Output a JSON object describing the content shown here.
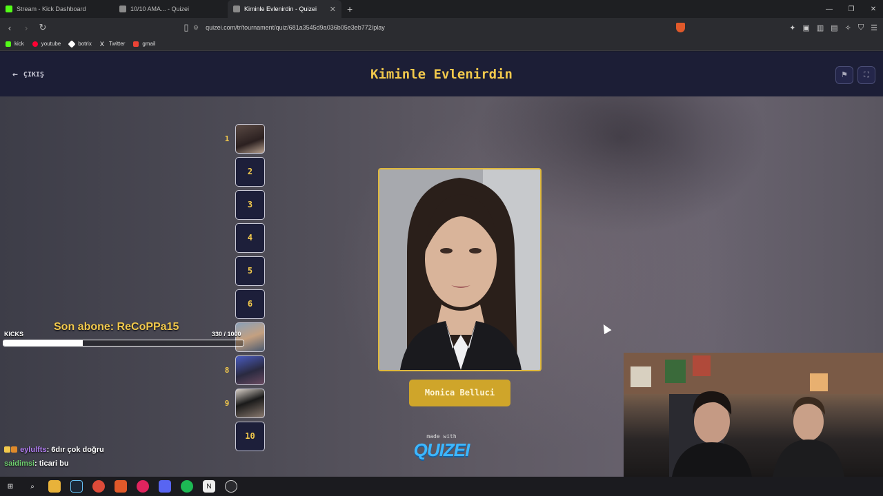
{
  "browser": {
    "tabs": [
      {
        "title": "Stream - Kick Dashboard",
        "active": false,
        "favicon_color": "#53fc18"
      },
      {
        "title": "10/10 AMA... - Quizei",
        "active": false,
        "favicon_color": "#8a8a8a"
      },
      {
        "title": "Kiminle Evlenirdin - Quizei",
        "active": true,
        "favicon_color": "#8a8a8a"
      }
    ],
    "new_tab": "+",
    "url": "quizei.com/tr/tournament/quiz/681a3545d9a036b05e3eb772/play",
    "bookmarks": [
      {
        "label": "kick",
        "color": "#53fc18"
      },
      {
        "label": "youtube",
        "color": "#ff0033"
      },
      {
        "label": "botrix",
        "color": "#ffffff"
      },
      {
        "label": "Twitter",
        "color": "#ffffff"
      },
      {
        "label": "gmail",
        "color": "#ea4335"
      }
    ]
  },
  "quiz": {
    "exit_label": "ÇIKIŞ",
    "title": "Kiminle Evlenirdin",
    "ranks": [
      {
        "num": "1",
        "filled": true,
        "label": ""
      },
      {
        "num": "",
        "filled": false,
        "label": "2"
      },
      {
        "num": "",
        "filled": false,
        "label": "3"
      },
      {
        "num": "",
        "filled": false,
        "label": "4"
      },
      {
        "num": "",
        "filled": false,
        "label": "5"
      },
      {
        "num": "",
        "filled": false,
        "label": "6"
      },
      {
        "num": "",
        "filled": true,
        "label": ""
      },
      {
        "num": "8",
        "filled": true,
        "label": ""
      },
      {
        "num": "9",
        "filled": true,
        "label": ""
      },
      {
        "num": "",
        "filled": false,
        "label": "10"
      }
    ],
    "candidate_name": "Monica Belluci",
    "made_with": "made with",
    "logo": "QUIZEI"
  },
  "stream_overlay": {
    "last_sub": "Son abone: ReCoPPa15",
    "kicks_label": "KICKS",
    "kicks_count": "330 / 1000",
    "kicks_progress": 0.33,
    "chat": [
      {
        "user": "eylulfts",
        "message": ": 6dır çok doğru"
      },
      {
        "user": "saidimsi",
        "message": ": ticari bu"
      }
    ]
  },
  "accent_colors": {
    "gold": "#f2c94c",
    "header_bg": "#1c1e36"
  }
}
